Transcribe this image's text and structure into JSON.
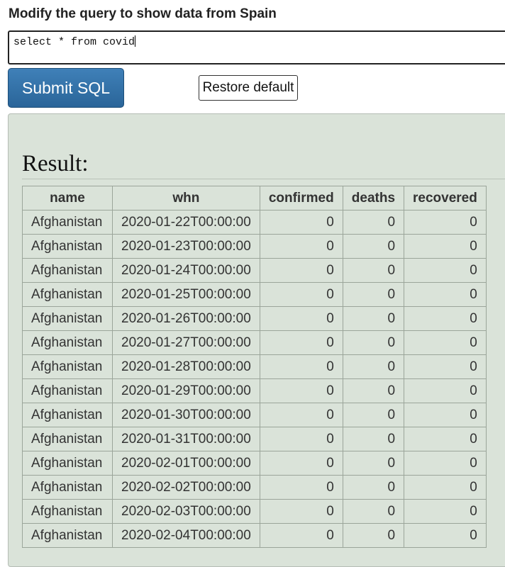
{
  "prompt": "Modify the query to show data from Spain",
  "sql_input": "select * from covid",
  "buttons": {
    "submit": "Submit SQL",
    "restore": "Restore default"
  },
  "result": {
    "title": "Result:",
    "columns": [
      "name",
      "whn",
      "confirmed",
      "deaths",
      "recovered"
    ],
    "rows": [
      [
        "Afghanistan",
        "2020-01-22T00:00:00",
        "0",
        "0",
        "0"
      ],
      [
        "Afghanistan",
        "2020-01-23T00:00:00",
        "0",
        "0",
        "0"
      ],
      [
        "Afghanistan",
        "2020-01-24T00:00:00",
        "0",
        "0",
        "0"
      ],
      [
        "Afghanistan",
        "2020-01-25T00:00:00",
        "0",
        "0",
        "0"
      ],
      [
        "Afghanistan",
        "2020-01-26T00:00:00",
        "0",
        "0",
        "0"
      ],
      [
        "Afghanistan",
        "2020-01-27T00:00:00",
        "0",
        "0",
        "0"
      ],
      [
        "Afghanistan",
        "2020-01-28T00:00:00",
        "0",
        "0",
        "0"
      ],
      [
        "Afghanistan",
        "2020-01-29T00:00:00",
        "0",
        "0",
        "0"
      ],
      [
        "Afghanistan",
        "2020-01-30T00:00:00",
        "0",
        "0",
        "0"
      ],
      [
        "Afghanistan",
        "2020-01-31T00:00:00",
        "0",
        "0",
        "0"
      ],
      [
        "Afghanistan",
        "2020-02-01T00:00:00",
        "0",
        "0",
        "0"
      ],
      [
        "Afghanistan",
        "2020-02-02T00:00:00",
        "0",
        "0",
        "0"
      ],
      [
        "Afghanistan",
        "2020-02-03T00:00:00",
        "0",
        "0",
        "0"
      ],
      [
        "Afghanistan",
        "2020-02-04T00:00:00",
        "0",
        "0",
        "0"
      ]
    ]
  },
  "colors": {
    "submit_bg": "#2e6da4",
    "panel_bg": "#dae3d9"
  }
}
